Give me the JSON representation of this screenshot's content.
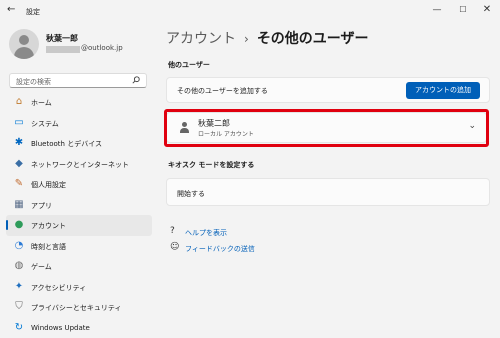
{
  "window": {
    "title": "設定",
    "back_glyph": "←",
    "min_glyph": "—",
    "max_glyph": "☐",
    "close_glyph": "✕"
  },
  "profile": {
    "name": "秋葉一郎",
    "email_suffix": "@outlook.jp"
  },
  "search": {
    "placeholder": "設定の検索",
    "icon": "search-icon"
  },
  "sidebar": {
    "items": [
      {
        "label": "ホーム",
        "icon": "home-icon",
        "glyph": "⌂",
        "color": "#c07a2e",
        "selected": false
      },
      {
        "label": "システム",
        "icon": "system-icon",
        "glyph": "▭",
        "color": "#0078d4",
        "selected": false
      },
      {
        "label": "Bluetooth とデバイス",
        "icon": "bluetooth-icon",
        "glyph": "✱",
        "color": "#0067c0",
        "selected": false
      },
      {
        "label": "ネットワークとインターネット",
        "icon": "network-icon",
        "glyph": "◆",
        "color": "#3a6ea5",
        "selected": false
      },
      {
        "label": "個人用設定",
        "icon": "personalization-icon",
        "glyph": "✎",
        "color": "#c06a2e",
        "selected": false
      },
      {
        "label": "アプリ",
        "icon": "apps-icon",
        "glyph": "▦",
        "color": "#5a6e8a",
        "selected": false
      },
      {
        "label": "アカウント",
        "icon": "accounts-icon",
        "glyph": "●",
        "color": "#2e9b5a",
        "selected": true
      },
      {
        "label": "時刻と言語",
        "icon": "time-language-icon",
        "glyph": "◔",
        "color": "#2b7bd6",
        "selected": false
      },
      {
        "label": "ゲーム",
        "icon": "gaming-icon",
        "glyph": "◍",
        "color": "#6b6b6b",
        "selected": false
      },
      {
        "label": "アクセシビリティ",
        "icon": "accessibility-icon",
        "glyph": "✦",
        "color": "#1f6fbf",
        "selected": false
      },
      {
        "label": "プライバシーとセキュリティ",
        "icon": "privacy-icon",
        "glyph": "⛉",
        "color": "#6b6b6b",
        "selected": false
      },
      {
        "label": "Windows Update",
        "icon": "windows-update-icon",
        "glyph": "↻",
        "color": "#0078d4",
        "selected": false
      }
    ]
  },
  "main": {
    "breadcrumb_parent": "アカウント",
    "breadcrumb_sep": "›",
    "breadcrumb_current": "その他のユーザー",
    "other_users_title": "他のユーザー",
    "add_user_text": "その他のユーザーを追加する",
    "add_account_button": "アカウントの追加",
    "account_name": "秋葉二郎",
    "account_type": "ローカル アカウント",
    "chevron_glyph": "⌄",
    "kiosk_title": "キオスク モードを設定する",
    "kiosk_start": "開始する",
    "help_link": "ヘルプを表示",
    "feedback_link": "フィードバックの送信",
    "help_glyph": "?",
    "feedback_glyph": "☺"
  },
  "colors": {
    "accent": "#005fb8",
    "highlight_border": "#e0000f"
  }
}
